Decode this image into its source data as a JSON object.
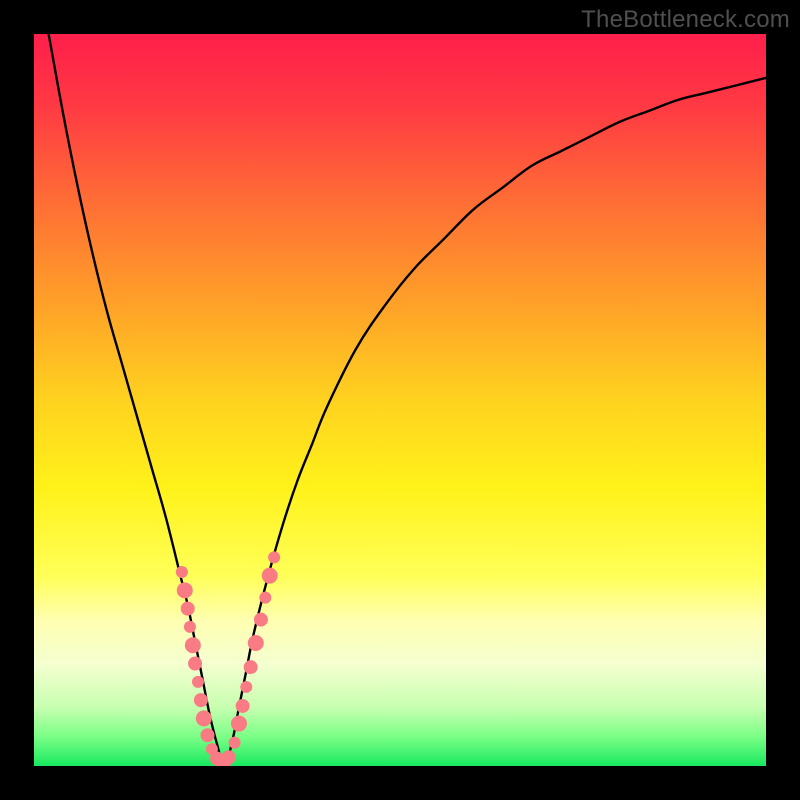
{
  "watermark": "TheBottleneck.com",
  "gradient": {
    "stops": [
      {
        "offset": 0.0,
        "color": "#ff1f4b"
      },
      {
        "offset": 0.1,
        "color": "#ff3a43"
      },
      {
        "offset": 0.22,
        "color": "#ff6a36"
      },
      {
        "offset": 0.35,
        "color": "#ff9a2a"
      },
      {
        "offset": 0.5,
        "color": "#ffd21f"
      },
      {
        "offset": 0.62,
        "color": "#fff21a"
      },
      {
        "offset": 0.74,
        "color": "#ffff58"
      },
      {
        "offset": 0.8,
        "color": "#ffffb0"
      },
      {
        "offset": 0.86,
        "color": "#f5ffd0"
      },
      {
        "offset": 0.92,
        "color": "#c7ffb0"
      },
      {
        "offset": 0.96,
        "color": "#7bff86"
      },
      {
        "offset": 1.0,
        "color": "#18e860"
      }
    ]
  },
  "chart_data": {
    "type": "line",
    "title": "",
    "xlabel": "",
    "ylabel": "",
    "xlim": [
      0,
      100
    ],
    "ylim": [
      0,
      100
    ],
    "series": [
      {
        "name": "bottleneck-curve",
        "x": [
          2,
          4,
          6,
          8,
          10,
          12,
          14,
          16,
          18,
          20,
          21,
          22,
          23,
          24,
          25,
          26,
          27,
          28,
          29,
          30,
          32,
          34,
          36,
          38,
          40,
          44,
          48,
          52,
          56,
          60,
          64,
          68,
          72,
          76,
          80,
          84,
          88,
          92,
          96,
          100
        ],
        "values": [
          100,
          89,
          79,
          70,
          62,
          55,
          48,
          41,
          34,
          26,
          22,
          17,
          12,
          7,
          3,
          0,
          3,
          8,
          13,
          18,
          26,
          33,
          39,
          44,
          49,
          57,
          63,
          68,
          72,
          76,
          79,
          82,
          84,
          86,
          88,
          89.5,
          91,
          92,
          93,
          94
        ]
      }
    ],
    "markers": {
      "name": "highlight-dots",
      "color": "#f97c84",
      "radius_range": [
        3.5,
        9
      ],
      "points": [
        {
          "x": 20.2,
          "y": 26.5,
          "r": 6
        },
        {
          "x": 20.6,
          "y": 24.0,
          "r": 8
        },
        {
          "x": 21.0,
          "y": 21.5,
          "r": 7
        },
        {
          "x": 21.3,
          "y": 19.0,
          "r": 6
        },
        {
          "x": 21.7,
          "y": 16.5,
          "r": 8
        },
        {
          "x": 22.0,
          "y": 14.0,
          "r": 7
        },
        {
          "x": 22.4,
          "y": 11.5,
          "r": 6
        },
        {
          "x": 22.8,
          "y": 9.0,
          "r": 7
        },
        {
          "x": 23.2,
          "y": 6.5,
          "r": 8
        },
        {
          "x": 23.7,
          "y": 4.2,
          "r": 7
        },
        {
          "x": 24.3,
          "y": 2.3,
          "r": 6
        },
        {
          "x": 25.0,
          "y": 1.0,
          "r": 7
        },
        {
          "x": 25.8,
          "y": 0.4,
          "r": 8
        },
        {
          "x": 26.6,
          "y": 1.2,
          "r": 7
        },
        {
          "x": 27.4,
          "y": 3.2,
          "r": 6
        },
        {
          "x": 28.0,
          "y": 5.8,
          "r": 8
        },
        {
          "x": 28.5,
          "y": 8.2,
          "r": 7
        },
        {
          "x": 29.0,
          "y": 10.8,
          "r": 6
        },
        {
          "x": 29.6,
          "y": 13.5,
          "r": 7
        },
        {
          "x": 30.3,
          "y": 16.8,
          "r": 8
        },
        {
          "x": 31.0,
          "y": 20.0,
          "r": 7
        },
        {
          "x": 31.6,
          "y": 23.0,
          "r": 6
        },
        {
          "x": 32.2,
          "y": 26.0,
          "r": 8
        },
        {
          "x": 32.8,
          "y": 28.5,
          "r": 6
        }
      ]
    }
  }
}
